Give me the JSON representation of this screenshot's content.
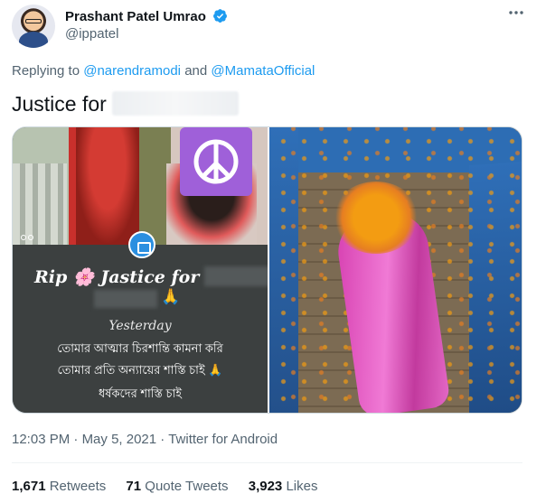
{
  "author": {
    "display_name": "Prashant Patel Umrao",
    "handle": "@ippatel",
    "verified": true,
    "verified_icon": "verified-badge-icon",
    "verified_color": "#1d9bf0"
  },
  "reply": {
    "prefix": "Replying to",
    "mention1": "@narendramodi",
    "conjunction": "and",
    "mention2": "@MamataOfficial"
  },
  "tweet": {
    "text": "Justice for"
  },
  "media": {
    "left_image": {
      "rip_prefix": "Rip",
      "rip_flower": "🌸",
      "rip_text": "Jastice for",
      "pray_emoji": "🙏",
      "day": "Yesterday",
      "line1": "তোমার আত্মার চিরশান্তি কামনা করি",
      "line2": "তোমার প্রতি অন্যায়ের শাস্তি চাই 🙏",
      "line3": "ধর্ষকদের শাস্তি চাই"
    }
  },
  "meta": {
    "time": "12:03 PM",
    "date": "May 5, 2021",
    "client": "Twitter for Android",
    "separator": "·"
  },
  "stats": {
    "retweets_count": "1,671",
    "retweets_label": "Retweets",
    "quote_count": "71",
    "quote_label": "Quote Tweets",
    "likes_count": "3,923",
    "likes_label": "Likes"
  },
  "colors": {
    "link": "#1d9bf0",
    "secondary_text": "#536471",
    "primary_text": "#0f1419"
  }
}
